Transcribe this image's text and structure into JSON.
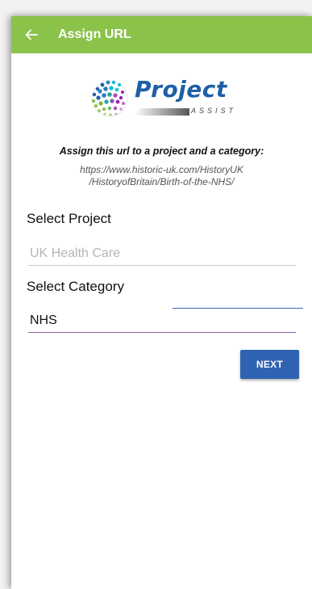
{
  "appbar": {
    "back_icon": "arrow-left-icon",
    "title": "Assign URL",
    "color": "#8bc34a"
  },
  "logo": {
    "word": "Project",
    "sub": "ASSIST",
    "colors": [
      "#1f5fa6",
      "#8bc34a",
      "#9c27b0",
      "#00bcd4"
    ]
  },
  "content": {
    "headline": "Assign this url to a project and a category:",
    "url_line1": "https://www.historic-uk.com/HistoryUK",
    "url_line2": "/HistoryofBritain/Birth-of-the-NHS/"
  },
  "project": {
    "label": "Select Project",
    "value": "UK Health Care"
  },
  "category": {
    "label": "Select Category",
    "value": "NHS"
  },
  "next_button": {
    "label": "NEXT",
    "color": "#2f63b1"
  }
}
